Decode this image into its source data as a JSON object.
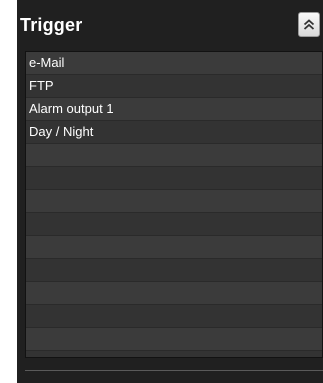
{
  "panel": {
    "title": "Trigger",
    "collapse_icon": "double-chevron-up-icon"
  },
  "trigger_list": {
    "items": [
      {
        "label": "e-Mail"
      },
      {
        "label": "FTP"
      },
      {
        "label": "Alarm output 1"
      },
      {
        "label": "Day / Night"
      }
    ],
    "empty_rows": 9
  },
  "colors": {
    "panel_background": "#202020",
    "list_row_odd": "#3b3b3b",
    "list_row_even": "#333333",
    "text": "#ffffff"
  }
}
